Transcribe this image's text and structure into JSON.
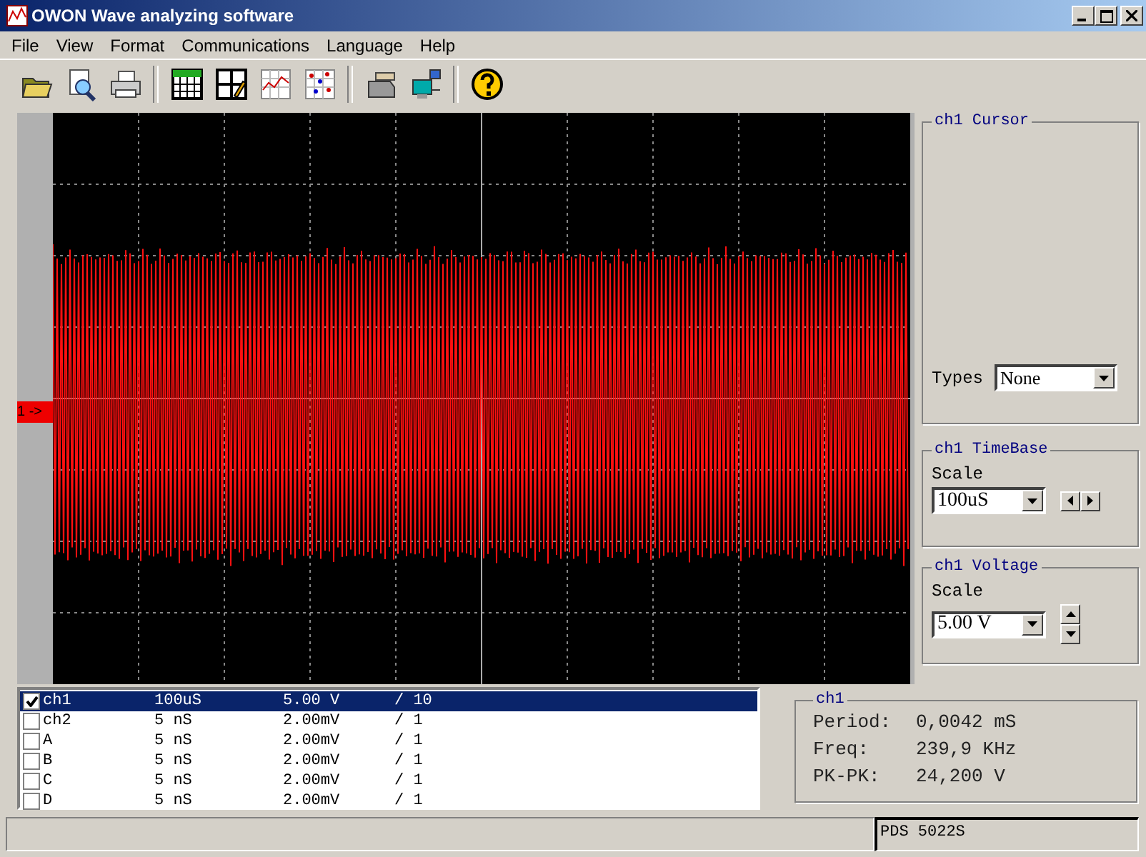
{
  "window": {
    "title": "OWON Wave analyzing software"
  },
  "menu": [
    "File",
    "View",
    "Format",
    "Communications",
    "Language",
    "Help"
  ],
  "scope": {
    "channel_marker": "1 ->"
  },
  "cursor_panel": {
    "title": "ch1 Cursor",
    "types_label": "Types",
    "types_value": "None"
  },
  "timebase_panel": {
    "title": "ch1 TimeBase",
    "scale_label": "Scale",
    "scale_value": "100uS"
  },
  "voltage_panel": {
    "title": "ch1 Voltage",
    "scale_label": "Scale",
    "scale_value": "5.00 V"
  },
  "channels": [
    {
      "name": "ch1",
      "timebase": "100uS",
      "volts": "5.00 V",
      "probe": "/ 10",
      "checked": true,
      "selected": true
    },
    {
      "name": "ch2",
      "timebase": "5  nS",
      "volts": "2.00mV",
      "probe": "/ 1",
      "checked": false,
      "selected": false
    },
    {
      "name": "A",
      "timebase": "5  nS",
      "volts": "2.00mV",
      "probe": "/ 1",
      "checked": false,
      "selected": false
    },
    {
      "name": "B",
      "timebase": "5  nS",
      "volts": "2.00mV",
      "probe": "/ 1",
      "checked": false,
      "selected": false
    },
    {
      "name": "C",
      "timebase": "5  nS",
      "volts": "2.00mV",
      "probe": "/ 1",
      "checked": false,
      "selected": false
    },
    {
      "name": "D",
      "timebase": "5  nS",
      "volts": "2.00mV",
      "probe": "/ 1",
      "checked": false,
      "selected": false
    }
  ],
  "measurements": {
    "title": "ch1",
    "rows": [
      {
        "label": "Period:",
        "value": "0,0042 mS"
      },
      {
        "label": "Freq:",
        "value": "239,9 KHz"
      },
      {
        "label": "PK-PK:",
        "value": "24,200 V"
      }
    ]
  },
  "status_bar": {
    "model": "PDS 5022S"
  }
}
